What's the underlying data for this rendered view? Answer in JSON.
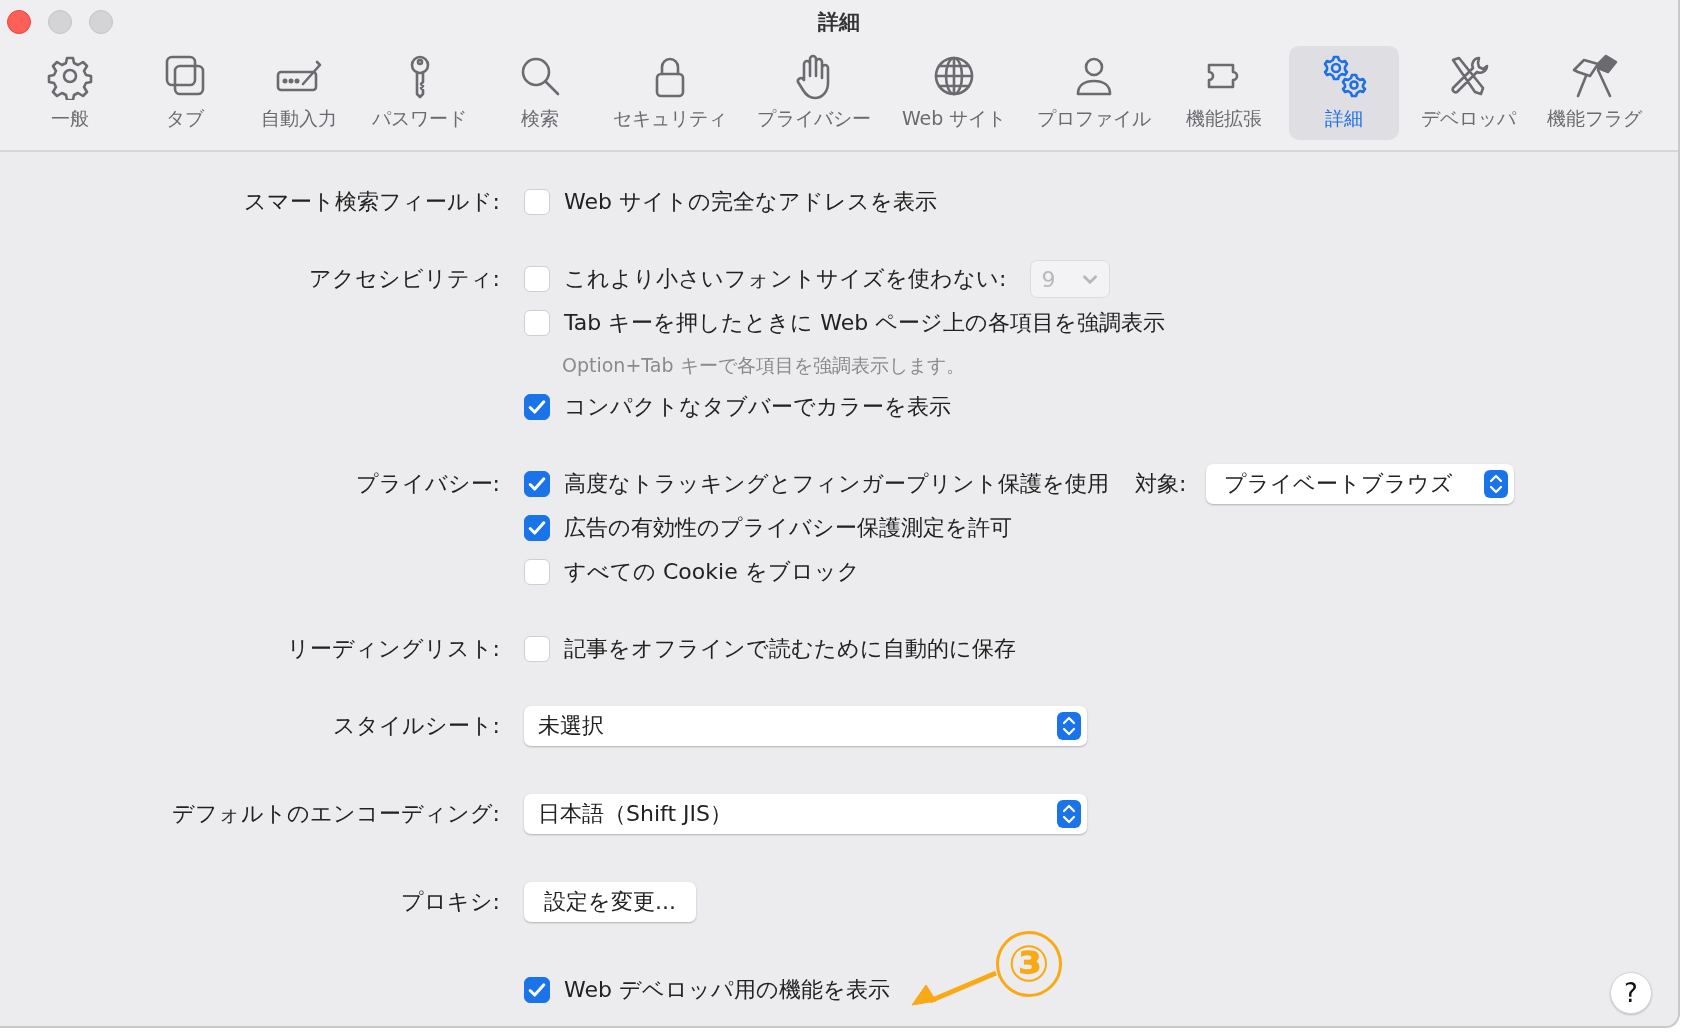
{
  "window": {
    "title": "詳細"
  },
  "toolbar": [
    {
      "label": "一般",
      "selected": false
    },
    {
      "label": "タブ",
      "selected": false
    },
    {
      "label": "自動入力",
      "selected": false
    },
    {
      "label": "パスワード",
      "selected": false
    },
    {
      "label": "検索",
      "selected": false
    },
    {
      "label": "セキュリティ",
      "selected": false
    },
    {
      "label": "プライバシー",
      "selected": false
    },
    {
      "label": "Web サイト",
      "selected": false
    },
    {
      "label": "プロファイル",
      "selected": false
    },
    {
      "label": "機能拡張",
      "selected": false
    },
    {
      "label": "詳細",
      "selected": true
    },
    {
      "label": "デベロッパ",
      "selected": false
    },
    {
      "label": "機能フラグ",
      "selected": false
    }
  ],
  "sections": [
    {
      "label": "スマート検索フィールド:",
      "items": [
        {
          "kind": "checkbox",
          "label": "Web サイトの完全なアドレスを表示",
          "checked": false
        }
      ]
    },
    {
      "label": "アクセシビリティ:",
      "items": [
        {
          "kind": "checkbox",
          "label": "これより小さいフォントサイズを使わない:",
          "checked": false,
          "select": {
            "value": "9",
            "disabled": true
          }
        },
        {
          "kind": "checkbox",
          "label": "Tab キーを押したときに Web ページ上の各項目を強調表示",
          "checked": false
        },
        {
          "kind": "hint",
          "text": "Option+Tab キーで各項目を強調表示します。"
        },
        {
          "kind": "checkbox",
          "label": "コンパクトなタブバーでカラーを表示",
          "checked": true
        }
      ]
    },
    {
      "label": "プライバシー:",
      "items": [
        {
          "kind": "checkbox",
          "label": "高度なトラッキングとフィンガープリント保護を使用",
          "checked": true,
          "target_label": "対象:",
          "select": {
            "value": "プライベートブラウズ",
            "disabled": false
          }
        },
        {
          "kind": "checkbox",
          "label": "広告の有効性のプライバシー保護測定を許可",
          "checked": true
        },
        {
          "kind": "checkbox",
          "label": "すべての Cookie をブロック",
          "checked": false
        }
      ]
    },
    {
      "label": "リーディングリスト:",
      "items": [
        {
          "kind": "checkbox",
          "label": "記事をオフラインで読むために自動的に保存",
          "checked": false
        }
      ]
    },
    {
      "label": "スタイルシート:",
      "items": [
        {
          "kind": "select",
          "value": "未選択"
        }
      ]
    },
    {
      "label": "デフォルトのエンコーディング:",
      "items": [
        {
          "kind": "select",
          "value": "日本語（Shift JIS）"
        }
      ]
    },
    {
      "label": "プロキシ:",
      "items": [
        {
          "kind": "button",
          "label": "設定を変更..."
        }
      ]
    },
    {
      "items": [
        {
          "kind": "checkbox",
          "label": "Web デベロッパ用の機能を表示",
          "checked": true,
          "annotation": "③"
        }
      ]
    }
  ],
  "help_button": "?"
}
